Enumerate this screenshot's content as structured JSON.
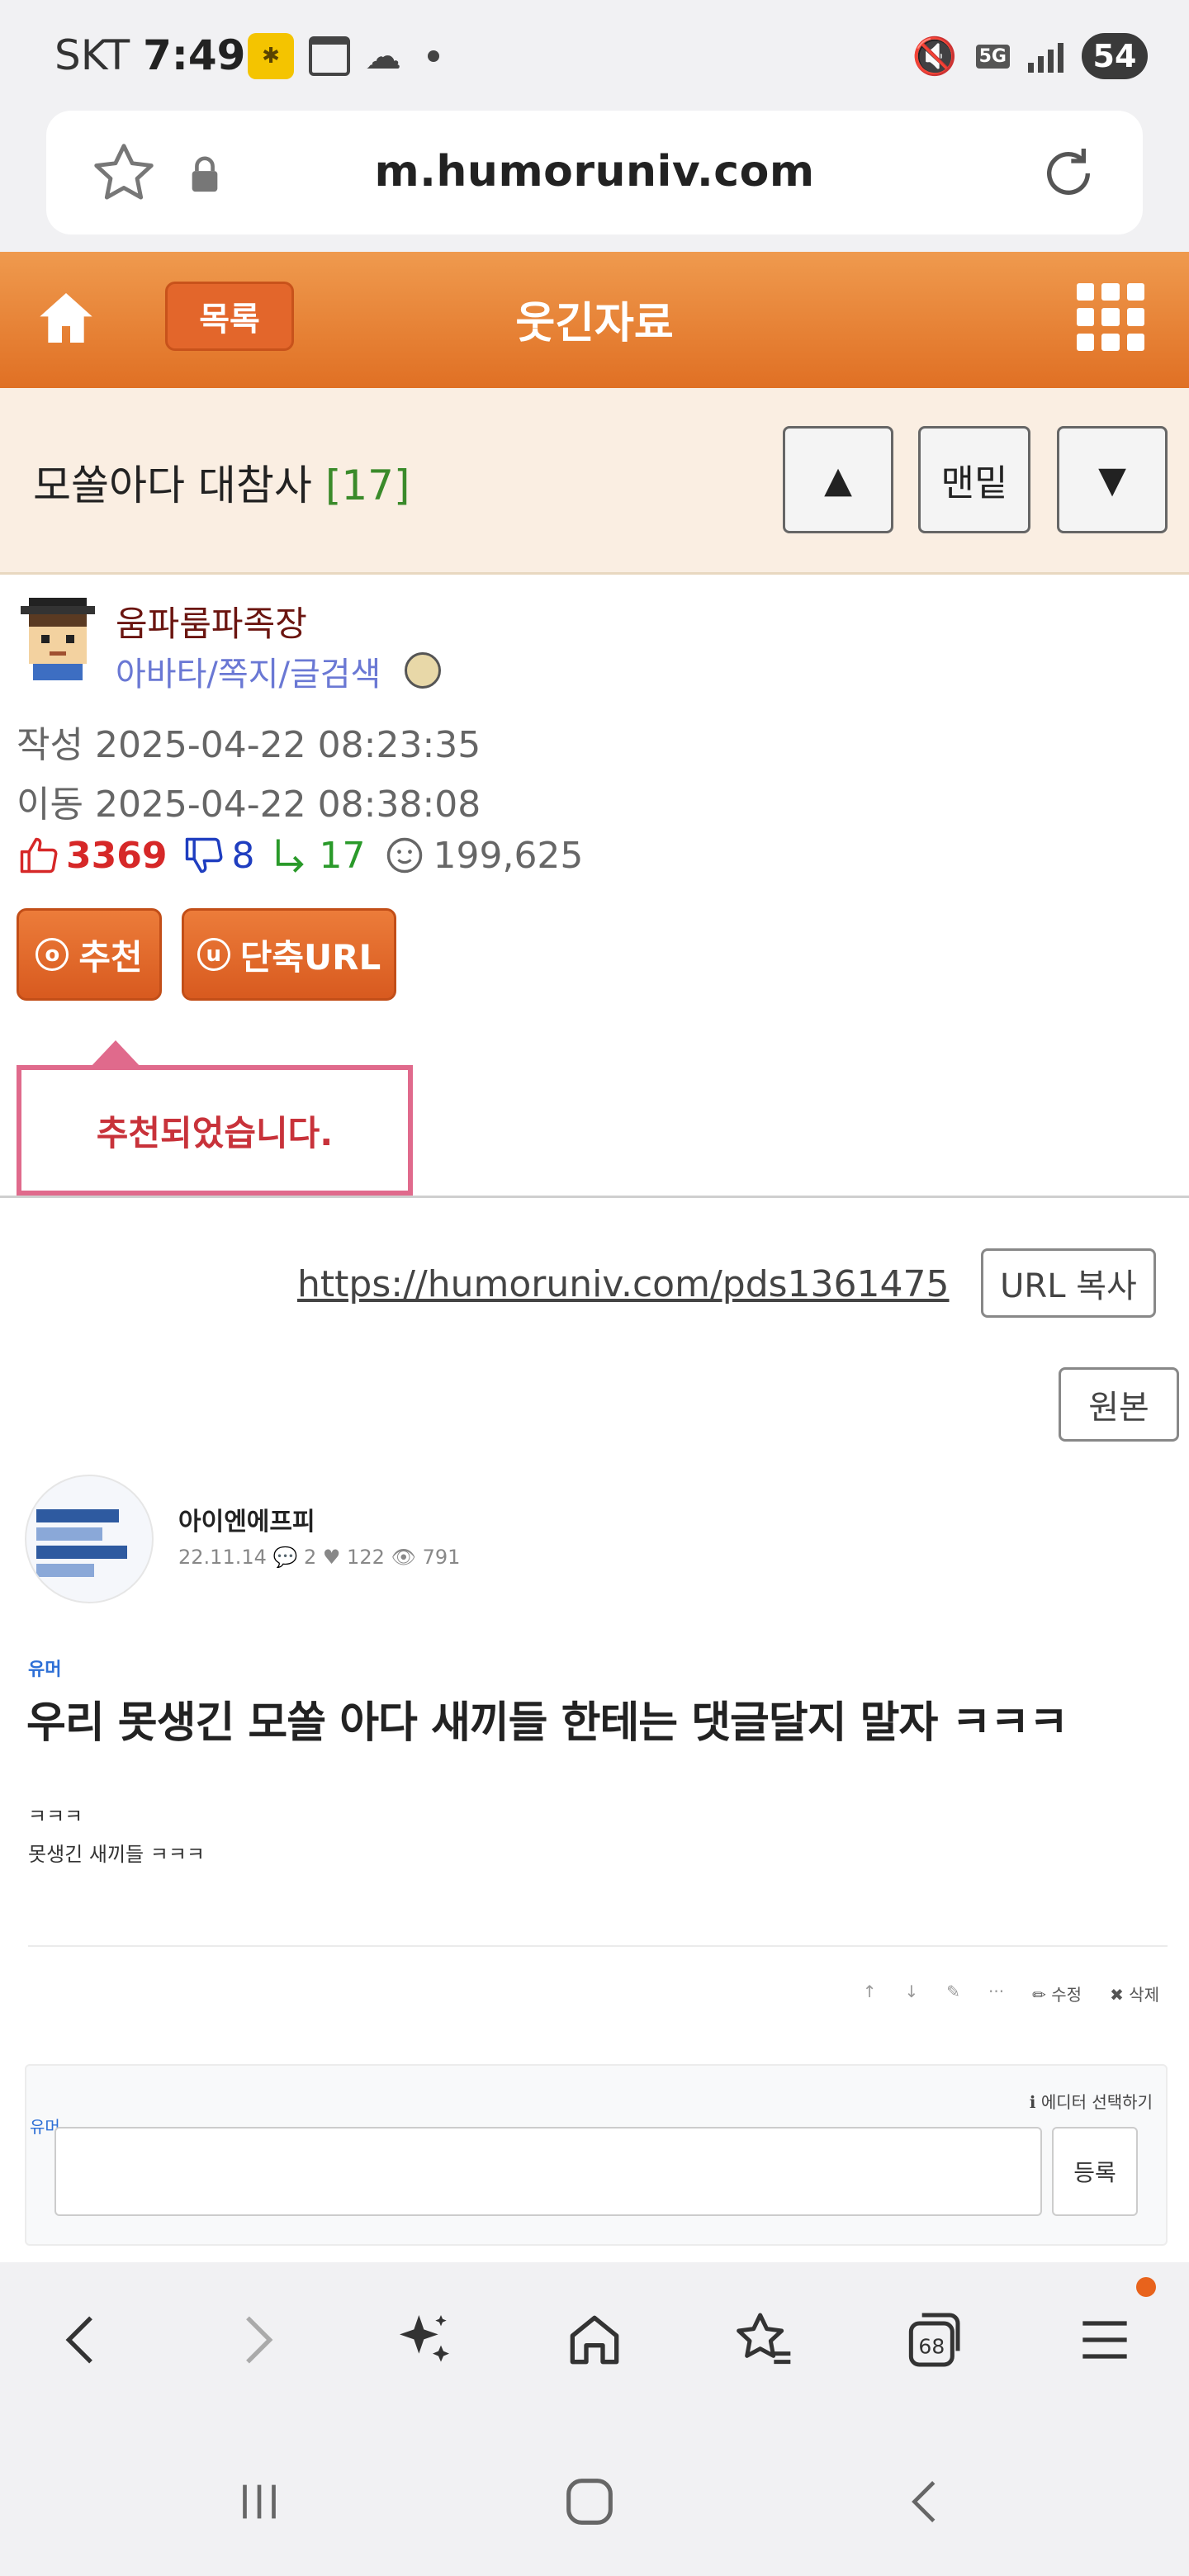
{
  "status_bar": {
    "carrier": "SKT",
    "time": "7:49",
    "network": "5G",
    "battery": "54"
  },
  "address_bar": {
    "url": "m.humoruniv.com"
  },
  "header": {
    "list_label": "목록",
    "category": "웃긴자료"
  },
  "post": {
    "title": "모쏠아다 대참사",
    "comment_count": "[17]",
    "nav_bottom_label": "맨밑",
    "author": "움파룸파족장",
    "author_links": "아바타/쪽지/글검색",
    "written": "작성 2025-04-22 08:23:35",
    "moved": "이동 2025-04-22 08:38:08",
    "stats": {
      "recommend": "3369",
      "oppose": "8",
      "replies": "17",
      "views": "199,625"
    },
    "recommend_button": "추천",
    "short_url_button": "단축URL",
    "recommend_letter": "o",
    "short_url_letter": "u",
    "toast": "추천되었습니다.",
    "short_url": "https://humoruniv.com/pds1361475",
    "copy_button": "URL 복사",
    "original_button": "원본"
  },
  "embedded": {
    "author": "아이엔에프피",
    "meta": "22.11.14  💬 2  ♥ 122  👁 791",
    "category": "유머",
    "title": "우리 못생긴 모쏠 아다 새끼들 한테는 댓글달지 말자 ㅋㅋㅋ",
    "body_line1": "ㅋㅋㅋ",
    "body_line2": "못생긴 새끼들 ㅋㅋㅋ",
    "tool_edit": "수정",
    "tool_delete": "삭제",
    "editor_category": "유머",
    "editor_pick": "에디터 선택하기",
    "submit": "등록"
  },
  "toolbar": {
    "tab_count": "68"
  },
  "colors": {
    "header_orange": "#e07024",
    "title_bg": "#faeee2",
    "recommend_red": "#d62828",
    "oppose_blue": "#1f3ec0",
    "reply_green": "#2a9a2a",
    "toast_border": "#e06a8c"
  }
}
